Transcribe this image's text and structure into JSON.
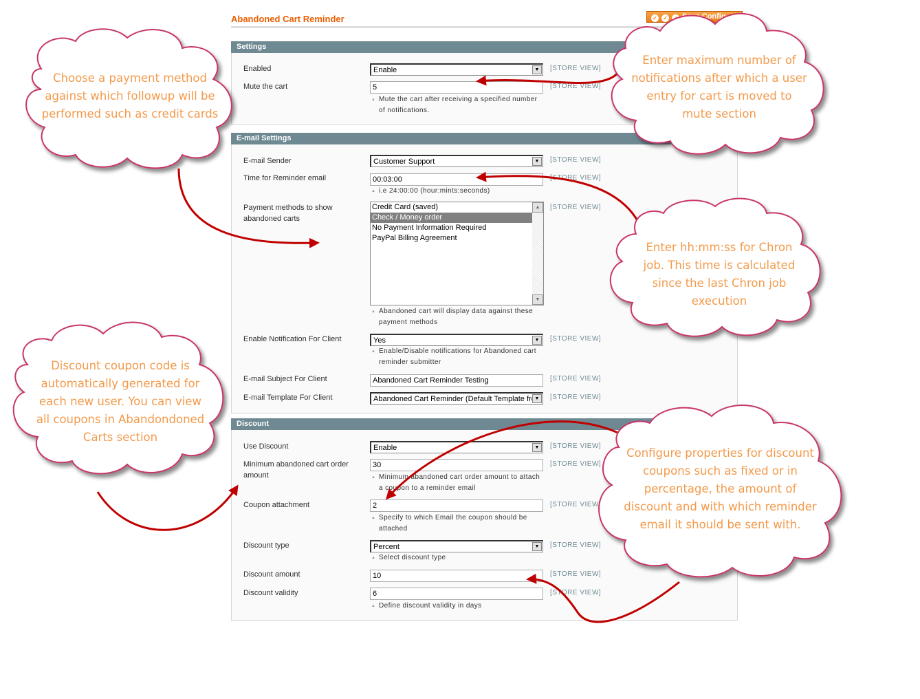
{
  "page": {
    "title": "Abandoned Cart Reminder",
    "save_button": "Save Config"
  },
  "scope_label": "[STORE VIEW]",
  "sections": {
    "settings": {
      "title": "Settings",
      "enabled": {
        "label": "Enabled",
        "value": "Enable"
      },
      "mute": {
        "label": "Mute the cart",
        "value": "5",
        "note": "Mute the cart after receiving a specified number of notifications."
      }
    },
    "email": {
      "title": "E-mail Settings",
      "sender": {
        "label": "E-mail Sender",
        "value": "Customer Support"
      },
      "time": {
        "label": "Time for Reminder email",
        "value": "00:03:00",
        "note": "i.e 24:00:00 (hour:mints:seconds)"
      },
      "payment": {
        "label": "Payment methods to show abandoned carts",
        "options": [
          "Credit Card (saved)",
          "Check / Money order",
          "No Payment Information Required",
          "PayPal Billing Agreement"
        ],
        "selected": "Check / Money order",
        "note": "Abandoned cart will display data against these payment methods"
      },
      "notify": {
        "label": "Enable Notification For Client",
        "value": "Yes",
        "note": "Enable/Disable notifications for Abandoned cart reminder submitter"
      },
      "subject": {
        "label": "E-mail Subject For Client",
        "value": "Abandoned Cart Reminder Testing"
      },
      "template": {
        "label": "E-mail Template For Client",
        "value": "Abandoned Cart Reminder (Default Template from Locale)"
      }
    },
    "discount": {
      "title": "Discount",
      "use": {
        "label": "Use Discount",
        "value": "Enable"
      },
      "min_amount": {
        "label": "Minimum abandoned cart order amount",
        "value": "30",
        "note": "Minimum abandoned cart order amount to attach a coupon to a reminder email"
      },
      "attachment": {
        "label": "Coupon attachment",
        "value": "2",
        "note": "Specify to which Email the coupon should be attached"
      },
      "type": {
        "label": "Discount type",
        "value": "Percent",
        "note": "Select discount type"
      },
      "amount": {
        "label": "Discount amount",
        "value": "10"
      },
      "validity": {
        "label": "Discount validity",
        "value": "6",
        "note": "Define discount validity in days"
      }
    }
  },
  "callouts": {
    "payment": "Choose a payment method against which followup will be performed such as credit cards",
    "mute": "Enter maximum number of notifications after which a user entry for cart is moved to mute section",
    "chron": "Enter hh:mm:ss for Chron job. This time is calculated since the last Chron job execution",
    "coupon": "Discount coupon code is automatically generated for each new user. You can view all coupons in Abandondoned Carts section",
    "discount": "Configure properties for discount coupons such as fixed or in percentage, the amount of discount and with which reminder email it should be sent with."
  },
  "colors": {
    "accent": "#eb5e00",
    "section_header": "#6f8992",
    "callout_border": "#c8366b",
    "callout_text": "#f39a4b",
    "arrow": "#c00000"
  }
}
